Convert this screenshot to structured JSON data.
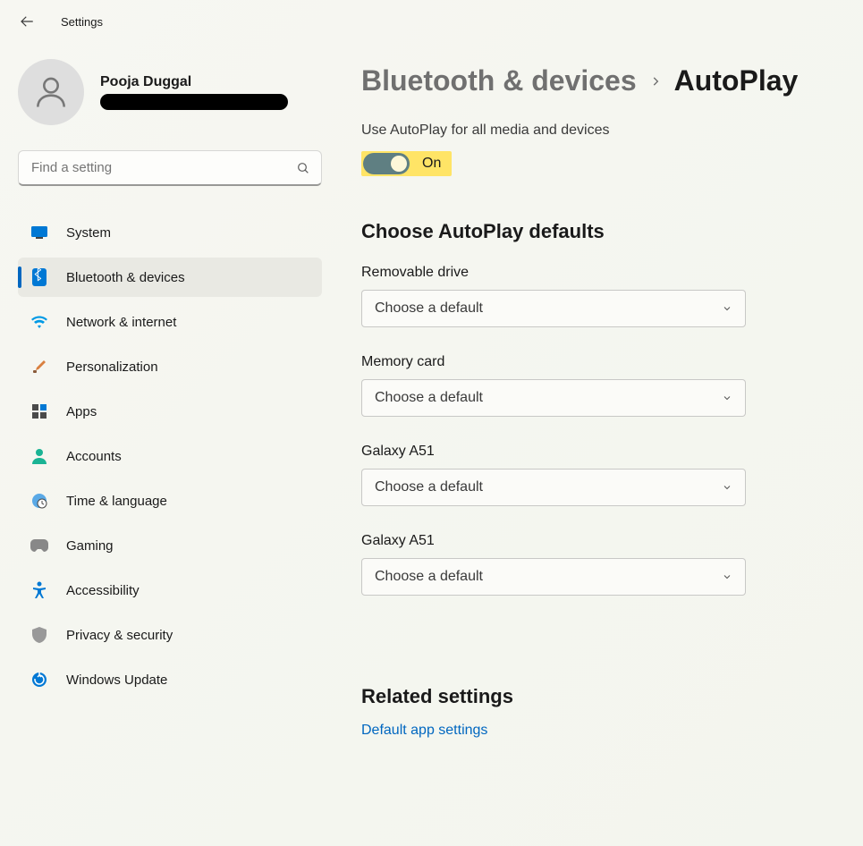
{
  "app_title": "Settings",
  "user": {
    "name": "Pooja Duggal"
  },
  "search": {
    "placeholder": "Find a setting"
  },
  "sidebar": {
    "items": [
      {
        "label": "System",
        "icon": "system-icon"
      },
      {
        "label": "Bluetooth & devices",
        "icon": "bluetooth-icon"
      },
      {
        "label": "Network & internet",
        "icon": "wifi-icon"
      },
      {
        "label": "Personalization",
        "icon": "brush-icon"
      },
      {
        "label": "Apps",
        "icon": "apps-icon"
      },
      {
        "label": "Accounts",
        "icon": "person-icon"
      },
      {
        "label": "Time & language",
        "icon": "clock-globe-icon"
      },
      {
        "label": "Gaming",
        "icon": "gamepad-icon"
      },
      {
        "label": "Accessibility",
        "icon": "accessibility-icon"
      },
      {
        "label": "Privacy & security",
        "icon": "shield-icon"
      },
      {
        "label": "Windows Update",
        "icon": "update-icon"
      }
    ],
    "active_index": 1
  },
  "breadcrumb": {
    "parent": "Bluetooth & devices",
    "current": "AutoPlay"
  },
  "toggle": {
    "label": "Use AutoPlay for all media and devices",
    "state": "On",
    "on": true,
    "highlighted": true
  },
  "defaults": {
    "heading": "Choose AutoPlay defaults",
    "placeholder": "Choose a default",
    "items": [
      {
        "label": "Removable drive",
        "value": "Choose a default"
      },
      {
        "label": "Memory card",
        "value": "Choose a default"
      },
      {
        "label": "Galaxy A51",
        "value": "Choose a default"
      },
      {
        "label": "Galaxy A51",
        "value": "Choose a default"
      }
    ]
  },
  "related": {
    "heading": "Related settings",
    "links": [
      "Default app settings"
    ]
  }
}
